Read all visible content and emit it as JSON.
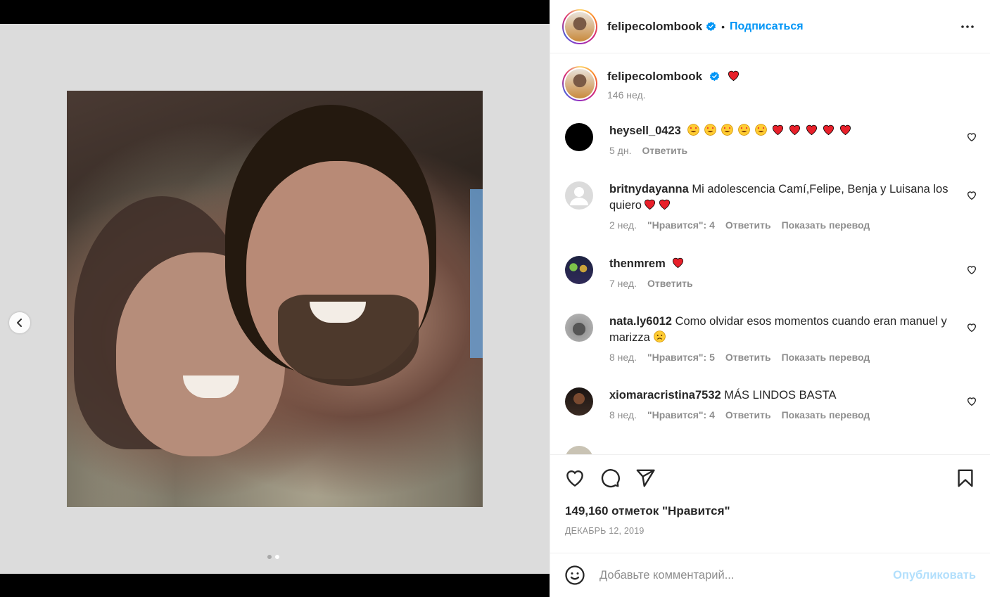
{
  "post": {
    "username": "felipecolombook",
    "follow_label": "Подписаться",
    "dot_sep": "•",
    "caption_time": "146 нед.",
    "likes": "149,160 отметок \"Нравится\"",
    "date": "ДЕКАБРЬ 12, 2019",
    "carousel": {
      "total": 2,
      "active_index": 1
    }
  },
  "comments": [
    {
      "user": "heysell_0423",
      "text": "",
      "emoji": "5x star-eyes, 5x red-heart",
      "time": "5 дн.",
      "likes": "",
      "reply": "Ответить",
      "translate": ""
    },
    {
      "user": "britnydayanna",
      "text": "Mi adolescencia Camí,Felipe, Benja y Luisana los quiero",
      "emoji": "2x red-heart",
      "time": "2 нед.",
      "likes": "\"Нравится\": 4",
      "reply": "Ответить",
      "translate": "Показать перевод"
    },
    {
      "user": "thenmrem",
      "text": "",
      "emoji": "1x red-heart",
      "time": "7 нед.",
      "likes": "",
      "reply": "Ответить",
      "translate": ""
    },
    {
      "user": "nata.ly6012",
      "text": "Como olvidar esos momentos cuando eran manuel y marizza",
      "emoji": "1x sad-face",
      "time": "8 нед.",
      "likes": "\"Нравится\": 5",
      "reply": "Ответить",
      "translate": "Показать перевод"
    },
    {
      "user": "xiomaracristina7532",
      "text": "MÁS LINDOS BASTA",
      "emoji": "",
      "time": "8 нед.",
      "likes": "\"Нравится\": 4",
      "reply": "Ответить",
      "translate": "Показать перевод"
    }
  ],
  "composer": {
    "placeholder": "Добавьте комментарий...",
    "post_label": "Опубликовать"
  },
  "colors": {
    "link": "#0095f6",
    "muted": "#8e8e8e",
    "post_disabled": "#b2dffc",
    "heart": "#ed4956"
  },
  "icons": [
    "chevron-left-icon",
    "verified-badge-icon",
    "more-icon",
    "heart-icon",
    "comment-icon",
    "share-icon",
    "bookmark-icon",
    "emoji-icon",
    "red-heart-emoji",
    "star-eyes-emoji",
    "sad-face-emoji"
  ]
}
